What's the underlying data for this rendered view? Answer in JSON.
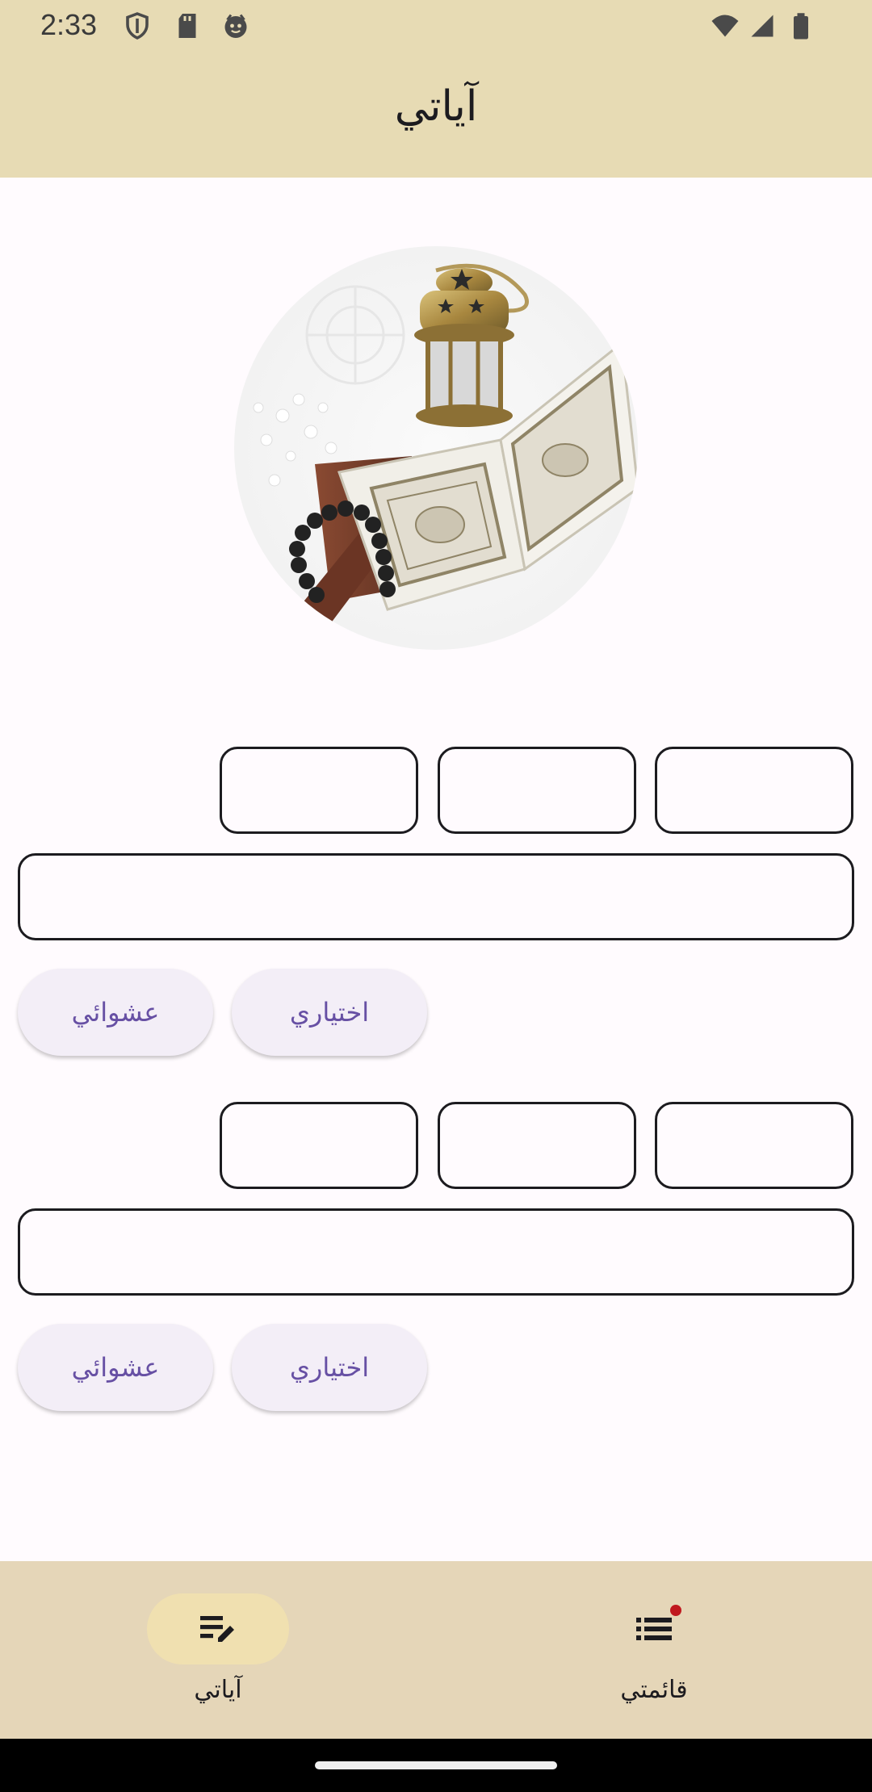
{
  "status_bar": {
    "time": "2:33",
    "left_icons": [
      "shield-icon",
      "sd-card-icon",
      "face-icon"
    ],
    "right_icons": [
      "wifi-icon",
      "signal-icon",
      "battery-icon"
    ]
  },
  "app_bar": {
    "title": "آياتي",
    "background": "#e7dbb4"
  },
  "hero_image": {
    "description_icon": "quran-lantern-image"
  },
  "groups": [
    {
      "small_fields": [
        "",
        "",
        ""
      ],
      "wide_field": "",
      "random_button": "عشوائي",
      "optional_button": "اختياري"
    },
    {
      "small_fields": [
        "",
        "",
        ""
      ],
      "wide_field": "",
      "random_button": "عشوائي",
      "optional_button": "اختياري"
    }
  ],
  "bottom_nav": {
    "items": [
      {
        "label": "آياتي",
        "icon": "edit-list-icon",
        "active": true
      },
      {
        "label": "قائمتي",
        "icon": "list-icon",
        "active": false,
        "badge": true
      }
    ],
    "background": "#e5d6b8",
    "active_pill": "#f0e0b0"
  },
  "accent_color": "#6750a4"
}
